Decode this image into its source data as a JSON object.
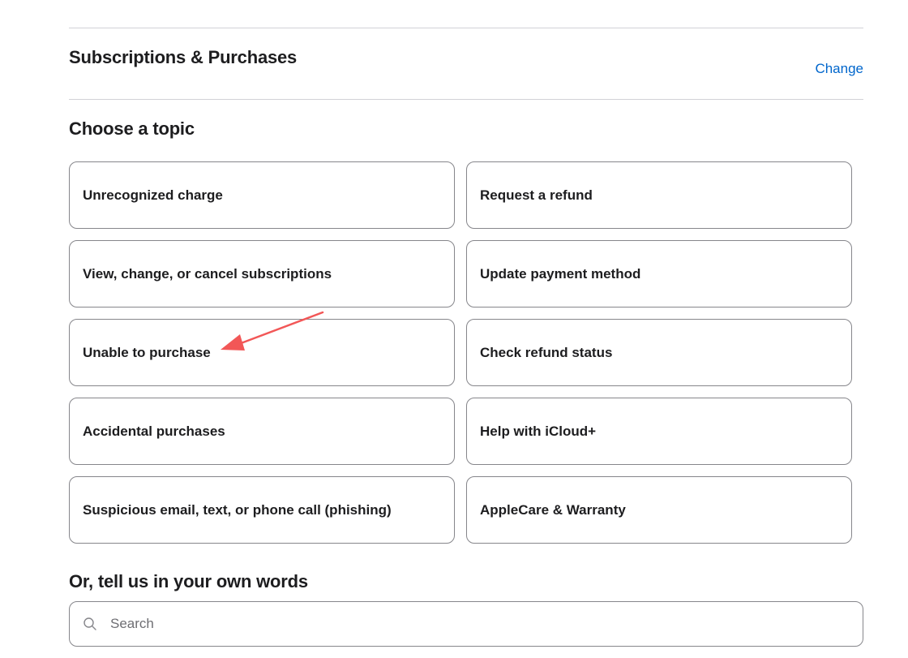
{
  "product": {
    "title": "Subscriptions & Purchases",
    "change_label": "Change"
  },
  "topics": {
    "title": "Choose a topic",
    "items": [
      {
        "label": "Unrecognized charge"
      },
      {
        "label": "Request a refund"
      },
      {
        "label": "View, change, or cancel subscriptions"
      },
      {
        "label": "Update payment method"
      },
      {
        "label": "Unable to purchase"
      },
      {
        "label": "Check refund status"
      },
      {
        "label": "Accidental purchases"
      },
      {
        "label": "Help with iCloud+"
      },
      {
        "label": "Suspicious email, text, or phone call (phishing)"
      },
      {
        "label": "AppleCare & Warranty"
      }
    ]
  },
  "own_words": {
    "title": "Or, tell us in your own words",
    "search_placeholder": "Search",
    "search_value": ""
  },
  "icons": {
    "search": "search-icon",
    "annotation": "annotation-arrow"
  },
  "colors": {
    "link": "#0066cc",
    "text": "#1d1d1f",
    "border": "#86868b",
    "divider": "#d2d2d7",
    "annotation": "#f25757"
  }
}
